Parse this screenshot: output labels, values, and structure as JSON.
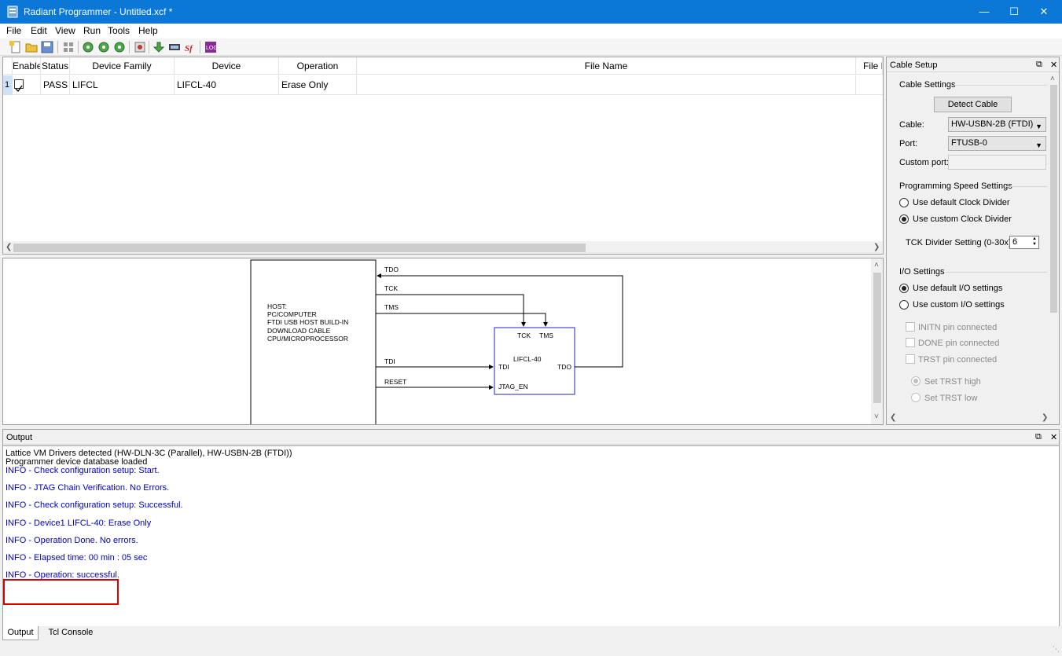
{
  "window": {
    "title": "Radiant Programmer - Untitled.xcf *"
  },
  "menu": [
    "File",
    "Edit",
    "View",
    "Run",
    "Tools",
    "Help"
  ],
  "grid": {
    "columns": [
      "Enable",
      "Status",
      "Device Family",
      "Device",
      "Operation",
      "File Name",
      "File D"
    ],
    "rows": [
      {
        "num": "1",
        "enabled": true,
        "status": "PASS",
        "family": "LIFCL",
        "device": "LIFCL-40",
        "operation": "Erase Only",
        "file": "",
        "filedate": ""
      }
    ]
  },
  "diagram": {
    "host_lines": [
      "HOST:",
      "PC/COMPUTER",
      "FTDI USB HOST BUILD-IN",
      "DOWNLOAD CABLE",
      "CPU/MICROPROCESSOR"
    ],
    "signals": {
      "tdo": "TDO",
      "tck": "TCK",
      "tms": "TMS",
      "tdi": "TDI",
      "reset": "RESET"
    },
    "chip": {
      "name": "LIFCL-40",
      "tck": "TCK",
      "tms": "TMS",
      "tdi": "TDI",
      "tdo": "TDO",
      "jtag_en": "JTAG_EN"
    }
  },
  "cable_setup": {
    "title": "Cable Setup",
    "cable_settings_title": "Cable Settings",
    "detect_button": "Detect Cable",
    "cable_label": "Cable:",
    "cable_value": "HW-USBN-2B (FTDI)",
    "port_label": "Port:",
    "port_value": "FTUSB-0",
    "custom_port_label": "Custom port:",
    "custom_port_value": "",
    "speed_title": "Programming Speed Settings",
    "speed_default": "Use default Clock Divider",
    "speed_custom": "Use custom Clock Divider",
    "tck_label": "TCK Divider Setting (0-30x):",
    "tck_value": "6",
    "io_title": "I/O Settings",
    "io_default": "Use default I/O settings",
    "io_custom": "Use custom I/O settings",
    "initn": "INITN pin connected",
    "done": "DONE pin connected",
    "trst": "TRST pin connected",
    "trst_high": "Set TRST high",
    "trst_low": "Set TRST low"
  },
  "output": {
    "title": "Output",
    "lines": [
      "Lattice VM Drivers detected (HW-DLN-3C (Parallel), HW-USBN-2B (FTDI))",
      "Programmer device database loaded",
      "INFO - Check configuration setup: Start.",
      "INFO - JTAG Chain Verification. No Errors.",
      "INFO - Check configuration setup: Successful.",
      "INFO - Device1 LIFCL-40: Erase Only",
      "INFO - Operation Done. No errors.",
      "INFO - Elapsed time: 00 min : 05 sec",
      "INFO - Operation: successful."
    ]
  },
  "tabs": [
    "Output",
    "Tcl Console"
  ]
}
